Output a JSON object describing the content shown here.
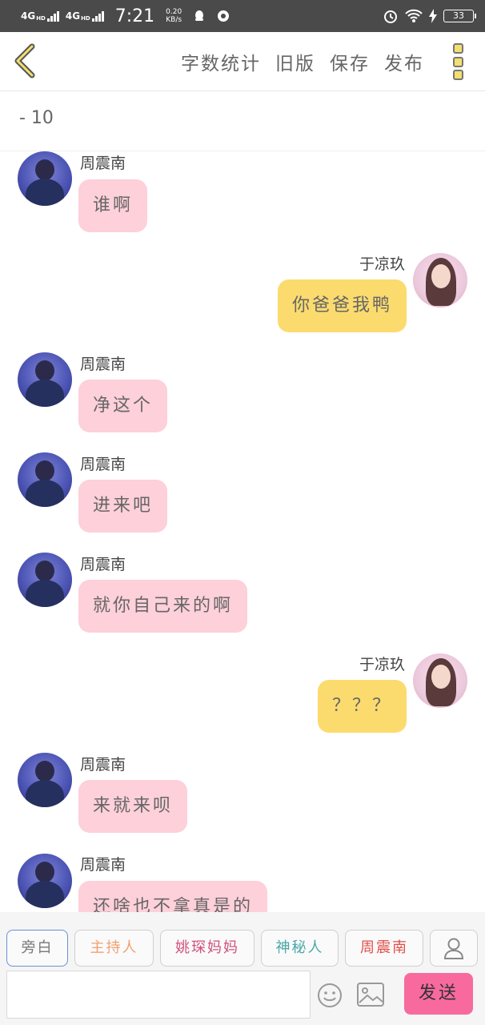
{
  "status_bar": {
    "network1": "4G",
    "network1_sup": "HD",
    "network2": "4G",
    "network2_sup": "HD",
    "time": "7:21",
    "speed_value": "0.20",
    "speed_unit": "KB/s",
    "battery": "33"
  },
  "header": {
    "actions": [
      "字数统计",
      "旧版",
      "保存",
      "发布"
    ],
    "back_icon": "chevron-left-icon",
    "more_icon": "more-vertical-icon"
  },
  "subheader": {
    "text": "- 10"
  },
  "messages": [
    {
      "side": "left",
      "name": "周震南",
      "text": "谁啊"
    },
    {
      "side": "right",
      "name": "于凉玖",
      "text": "你爸爸我鸭"
    },
    {
      "side": "left",
      "name": "周震南",
      "text": "净这个"
    },
    {
      "side": "left",
      "name": "周震南",
      "text": "进来吧"
    },
    {
      "side": "left",
      "name": "周震南",
      "text": "就你自己来的啊"
    },
    {
      "side": "right",
      "name": "于凉玖",
      "text": "？？？"
    },
    {
      "side": "left",
      "name": "周震南",
      "text": "来就来呗"
    },
    {
      "side": "left",
      "name": "周震南",
      "text": "还啥也不拿真是的"
    }
  ],
  "roles": [
    {
      "label": "旁白",
      "color": "#777777"
    },
    {
      "label": "主持人",
      "color": "#f0a070"
    },
    {
      "label": "姚琛妈妈",
      "color": "#d0507a"
    },
    {
      "label": "神秘人",
      "color": "#4aa8a8"
    },
    {
      "label": "周震南",
      "color": "#e0504a"
    }
  ],
  "input": {
    "placeholder": ""
  },
  "send_label": "发送",
  "colors": {
    "pink_bubble": "#fdd0da",
    "yellow_bubble": "#fbdb6e",
    "send_button": "#f86a9d"
  }
}
